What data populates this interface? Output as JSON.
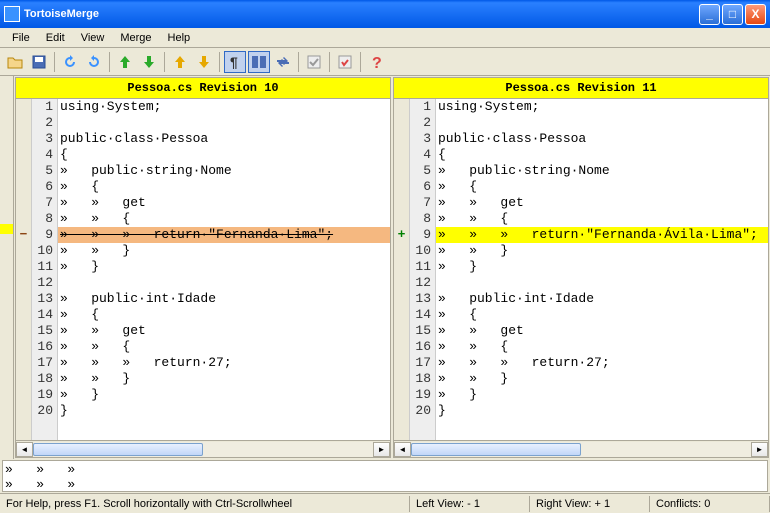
{
  "title": "TortoiseMerge",
  "menu": {
    "file": "File",
    "edit": "Edit",
    "view": "View",
    "merge": "Merge",
    "help": "Help"
  },
  "panes": {
    "left": {
      "header": "Pessoa.cs Revision 10",
      "lines": [
        {
          "n": "1",
          "t": "using·System;"
        },
        {
          "n": "2",
          "t": ""
        },
        {
          "n": "3",
          "t": "public·class·Pessoa"
        },
        {
          "n": "4",
          "t": "{"
        },
        {
          "n": "5",
          "t": "»   public·string·Nome"
        },
        {
          "n": "6",
          "t": "»   {"
        },
        {
          "n": "7",
          "t": "»   »   get"
        },
        {
          "n": "8",
          "t": "»   »   {"
        },
        {
          "n": "9",
          "t": "»   »   »   return·\"Fernanda·Lima\";",
          "cls": "line-removed",
          "mark": "minus"
        },
        {
          "n": "10",
          "t": "»   »   }"
        },
        {
          "n": "11",
          "t": "»   }"
        },
        {
          "n": "12",
          "t": ""
        },
        {
          "n": "13",
          "t": "»   public·int·Idade"
        },
        {
          "n": "14",
          "t": "»   {"
        },
        {
          "n": "15",
          "t": "»   »   get"
        },
        {
          "n": "16",
          "t": "»   »   {"
        },
        {
          "n": "17",
          "t": "»   »   »   return·27;"
        },
        {
          "n": "18",
          "t": "»   »   }"
        },
        {
          "n": "19",
          "t": "»   }"
        },
        {
          "n": "20",
          "t": "}"
        }
      ]
    },
    "right": {
      "header": "Pessoa.cs Revision 11",
      "lines": [
        {
          "n": "1",
          "t": "using·System;"
        },
        {
          "n": "2",
          "t": ""
        },
        {
          "n": "3",
          "t": "public·class·Pessoa"
        },
        {
          "n": "4",
          "t": "{"
        },
        {
          "n": "5",
          "t": "»   public·string·Nome"
        },
        {
          "n": "6",
          "t": "»   {"
        },
        {
          "n": "7",
          "t": "»   »   get"
        },
        {
          "n": "8",
          "t": "»   »   {"
        },
        {
          "n": "9",
          "t": "»   »   »   return·\"Fernanda·Ávila·Lima\";",
          "cls": "line-added",
          "mark": "plus"
        },
        {
          "n": "10",
          "t": "»   »   }"
        },
        {
          "n": "11",
          "t": "»   }"
        },
        {
          "n": "12",
          "t": ""
        },
        {
          "n": "13",
          "t": "»   public·int·Idade"
        },
        {
          "n": "14",
          "t": "»   {"
        },
        {
          "n": "15",
          "t": "»   »   get"
        },
        {
          "n": "16",
          "t": "»   »   {"
        },
        {
          "n": "17",
          "t": "»   »   »   return·27;"
        },
        {
          "n": "18",
          "t": "»   »   }"
        },
        {
          "n": "19",
          "t": "»   }"
        },
        {
          "n": "20",
          "t": "}"
        }
      ]
    }
  },
  "bottom": "»   »   »\n»   »   »",
  "status": {
    "help": "For Help, press F1. Scroll horizontally with Ctrl-Scrollwheel",
    "left": "Left View: - 1",
    "right": "Right View: + 1",
    "conflicts": "Conflicts: 0"
  }
}
